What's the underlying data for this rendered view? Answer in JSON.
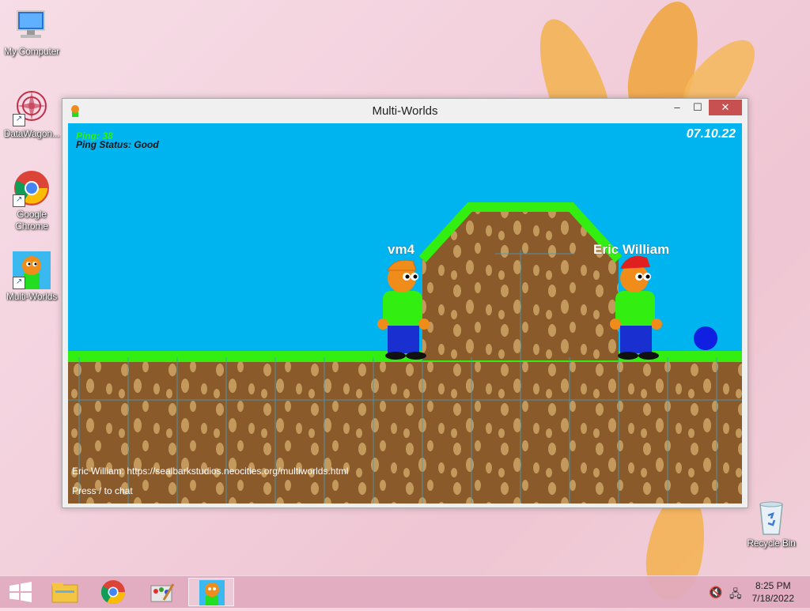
{
  "desktop": {
    "icons": [
      {
        "label": "My Computer",
        "icon": "computer-icon"
      },
      {
        "label": "DataWagon...",
        "icon": "datawagon-icon"
      },
      {
        "label": "Google Chrome",
        "icon": "chrome-icon"
      },
      {
        "label": "Multi-Worlds",
        "icon": "multiworlds-icon"
      },
      {
        "label": "Recycle Bin",
        "icon": "recycle-bin-icon"
      }
    ]
  },
  "window": {
    "title": "Multi-Worlds",
    "minimize": "–",
    "maximize": "☐",
    "close": "✕"
  },
  "game": {
    "ping_label": "Ping: 38",
    "ping_status": "Ping Status: Good",
    "date": "07.10.22",
    "players": [
      {
        "name": "vm4"
      },
      {
        "name": "Eric William"
      }
    ],
    "chat": [
      "Eric William: https://sealbarkstudios.neocities.org/multiworlds.html",
      "Press / to chat"
    ],
    "colors": {
      "sky": "#00b4f0",
      "grass": "#33ee11",
      "dirt": "#8b5a2b",
      "ball": "#1020e0"
    }
  },
  "taskbar": {
    "items": [
      "start-icon",
      "file-explorer-icon",
      "chrome-icon",
      "paint-icon",
      "multiworlds-icon"
    ],
    "time": "8:25 PM",
    "date": "7/18/2022"
  }
}
